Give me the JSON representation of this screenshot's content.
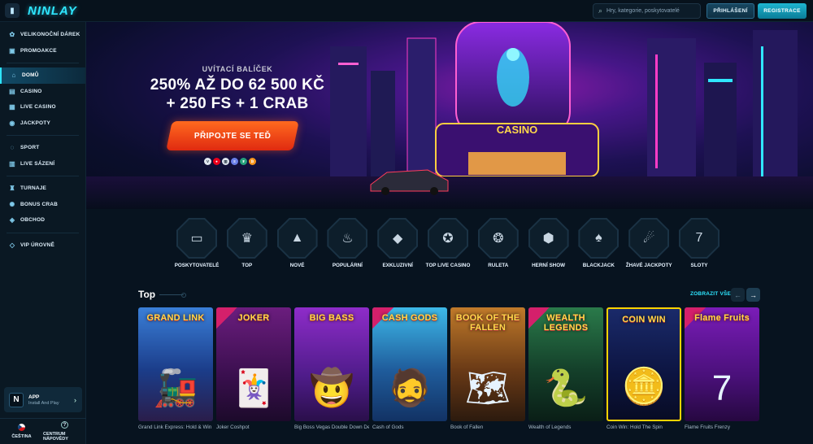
{
  "header": {
    "logo": "NINLAY",
    "search_placeholder": "Hry, kategorie, poskytovatelé",
    "login_label": "PŘIHLÁŠENÍ",
    "register_label": "REGISTRACE"
  },
  "sidebar": {
    "groups": [
      [
        {
          "label": "VELIKONOČNÍ DÁREK",
          "icon": "easter-egg-icon",
          "glyph": "✿"
        },
        {
          "label": "PROMOAKCE",
          "icon": "gift-icon",
          "glyph": "▣"
        }
      ],
      [
        {
          "label": "DOMŮ",
          "icon": "home-icon",
          "glyph": "⌂",
          "active": true
        },
        {
          "label": "CASINO",
          "icon": "casino-icon",
          "glyph": "▤"
        },
        {
          "label": "LIVE CASINO",
          "icon": "live-casino-icon",
          "glyph": "▦"
        },
        {
          "label": "JACKPOTY",
          "icon": "jackpot-icon",
          "glyph": "◉"
        }
      ],
      [
        {
          "label": "SPORT",
          "icon": "sport-icon",
          "glyph": "◌"
        },
        {
          "label": "LIVE SÁZENÍ",
          "icon": "live-betting-icon",
          "glyph": "▥"
        }
      ],
      [
        {
          "label": "TURNAJE",
          "icon": "trophy-icon",
          "glyph": "♜"
        },
        {
          "label": "BONUS CRAB",
          "icon": "crab-icon",
          "glyph": "✺"
        },
        {
          "label": "OBCHOD",
          "icon": "shop-icon",
          "glyph": "◈"
        }
      ],
      [
        {
          "label": "VIP ÚROVNĚ",
          "icon": "diamond-icon",
          "glyph": "◇"
        }
      ]
    ],
    "app": {
      "logo": "N",
      "title": "APP",
      "subtitle": "Install And Play"
    },
    "footer": {
      "language": "ČEŠTINA",
      "help": "CENTRUM NÁPOVĚDY"
    }
  },
  "hero": {
    "subtitle": "UVÍTACÍ BALÍČEK",
    "line1": "250% AŽ DO 62 500 KČ",
    "line2": "+ 250 FS + 1 CRAB",
    "cta": "PŘIPOJTE SE TEĎ",
    "casino_sign": "CASINO",
    "payment_icons": [
      "visa-icon",
      "mastercard-icon",
      "bank-icon",
      "ethereum-icon",
      "tether-icon",
      "bitcoin-icon"
    ]
  },
  "categories": [
    {
      "label": "POSKYTOVATELÉ",
      "icon": "book-icon",
      "glyph": "▭"
    },
    {
      "label": "TOP",
      "icon": "crown-icon",
      "glyph": "♛"
    },
    {
      "label": "NOVÉ",
      "icon": "rocket-icon",
      "glyph": "▲"
    },
    {
      "label": "POPULÁRNÍ",
      "icon": "flame-icon",
      "glyph": "♨"
    },
    {
      "label": "EXKLUZIVNÍ",
      "icon": "diamond-icon",
      "glyph": "◆"
    },
    {
      "label": "TOP LIVE CASINO",
      "icon": "medal-icon",
      "glyph": "✪"
    },
    {
      "label": "RULETA",
      "icon": "roulette-icon",
      "glyph": "❂"
    },
    {
      "label": "HERNÍ SHOW",
      "icon": "show-icon",
      "glyph": "⬢"
    },
    {
      "label": "BLACKJACK",
      "icon": "cards-icon",
      "glyph": "♠"
    },
    {
      "label": "ŽHAVÉ JACKPOTY",
      "icon": "hot-jackpot-icon",
      "glyph": "☄"
    },
    {
      "label": "SLOTY",
      "icon": "slots-icon",
      "glyph": "7"
    }
  ],
  "top_section": {
    "title": "Top",
    "show_all": "ZOBRAZIT VŠE",
    "games": [
      {
        "name": "Grand Link Express: Hold & Win",
        "title": "GRAND LINK",
        "art": "🚂",
        "bg": "linear-gradient(#3a7fd8,#1b3d8a 55%,#2a1d4a)",
        "badge": false
      },
      {
        "name": "Joker Coshpot",
        "title": "JOKER",
        "art": "🃏",
        "bg": "linear-gradient(#6b1d7e,#3a0f4e 60%,#1c0a2a)",
        "badge": true
      },
      {
        "name": "Big Boss Vegas Double Down Del...",
        "title": "BIG BASS",
        "art": "🤠",
        "bg": "linear-gradient(#8e2cc9,#4f1c8a 60%,#2a0f4a)",
        "badge": false
      },
      {
        "name": "Cash of Gods",
        "title": "CASH GODS",
        "art": "🧔",
        "bg": "linear-gradient(#3db9e8,#1f5c9c 55%,#123264)",
        "badge": true
      },
      {
        "name": "Book of Fallen",
        "title": "BOOK OF THE FALLEN",
        "art": "🗺",
        "bg": "linear-gradient(#c07a2a,#6a3a16 55%,#2c1a0e)",
        "badge": false
      },
      {
        "name": "Wealth of Legends",
        "title": "WEALTH LEGENDS",
        "art": "🐍",
        "bg": "linear-gradient(#2a7a4a,#14402a 55%,#0a1e16)",
        "badge": true
      },
      {
        "name": "Coin Win: Hold The Spin",
        "title": "COIN WIN",
        "art": "🪙",
        "bg": "linear-gradient(#1a2a6a,#0c1440 60%,#080c24)",
        "badge": false
      },
      {
        "name": "Flame Fruits Frenzy",
        "title": "Flame Fruits",
        "art": "7",
        "bg": "linear-gradient(#7a1cb8,#4a107a 60%,#260840)",
        "badge": true
      }
    ]
  }
}
